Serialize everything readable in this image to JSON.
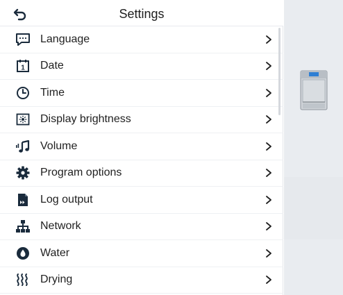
{
  "header": {
    "title": "Settings",
    "back_icon": "back-arrow-icon"
  },
  "menu": {
    "items": [
      {
        "label": "Language",
        "icon": "speech-bubble-icon"
      },
      {
        "label": "Date",
        "icon": "calendar-icon"
      },
      {
        "label": "Time",
        "icon": "clock-icon"
      },
      {
        "label": "Display brightness",
        "icon": "brightness-icon"
      },
      {
        "label": "Volume",
        "icon": "music-note-icon"
      },
      {
        "label": "Program options",
        "icon": "gear-icon"
      },
      {
        "label": "Log output",
        "icon": "document-icon"
      },
      {
        "label": "Network",
        "icon": "network-icon"
      },
      {
        "label": "Water",
        "icon": "water-drop-icon"
      },
      {
        "label": "Drying",
        "icon": "drying-icon"
      }
    ],
    "chevron": ">",
    "calendar_day": "1"
  },
  "colors": {
    "accent": "#1a2b3c",
    "side_panel": "#e9ecf0",
    "device_screen": "#2f7fd4"
  }
}
